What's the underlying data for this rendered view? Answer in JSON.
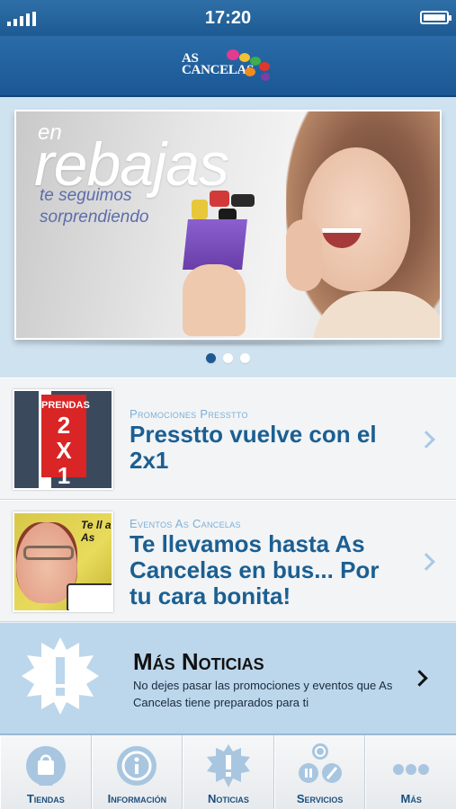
{
  "status_bar": {
    "time": "17:20"
  },
  "header": {
    "logo_line1": "AS",
    "logo_line2": "CANCELAS"
  },
  "banner": {
    "prefix": "en",
    "title": "rebajas",
    "subtitle": "te seguimos sorprendiendo",
    "pages": 3,
    "active_page": 1
  },
  "news": [
    {
      "category": "Promociones Presstto",
      "title": "Presstto vuelve con el 2x1",
      "thumb_line1": "PRENDAS",
      "thumb_line2": "2",
      "thumb_line3": "X",
      "thumb_line4": "1"
    },
    {
      "category": "Eventos As Cancelas",
      "title": "Te llevamos hasta As Cancelas en bus... Por tu cara bonita!",
      "thumb_text": "Te ll a As"
    }
  ],
  "more_news": {
    "title": "Más Noticias",
    "description": "No dejes pasar las promociones y eventos que As Cancelas tiene preparados para ti"
  },
  "tabs": [
    {
      "label": "Tiendas",
      "icon": "shopping-bag-icon"
    },
    {
      "label": "Información",
      "icon": "info-icon"
    },
    {
      "label": "Noticias",
      "icon": "burst-exclamation-icon"
    },
    {
      "label": "Servicios",
      "icon": "services-icon"
    },
    {
      "label": "Más",
      "icon": "more-dots-icon"
    }
  ],
  "colors": {
    "nav_blue": "#1d5a93",
    "title_blue": "#1b5f92",
    "category_blue": "#7dafd6",
    "background": "#cfe2ef"
  }
}
